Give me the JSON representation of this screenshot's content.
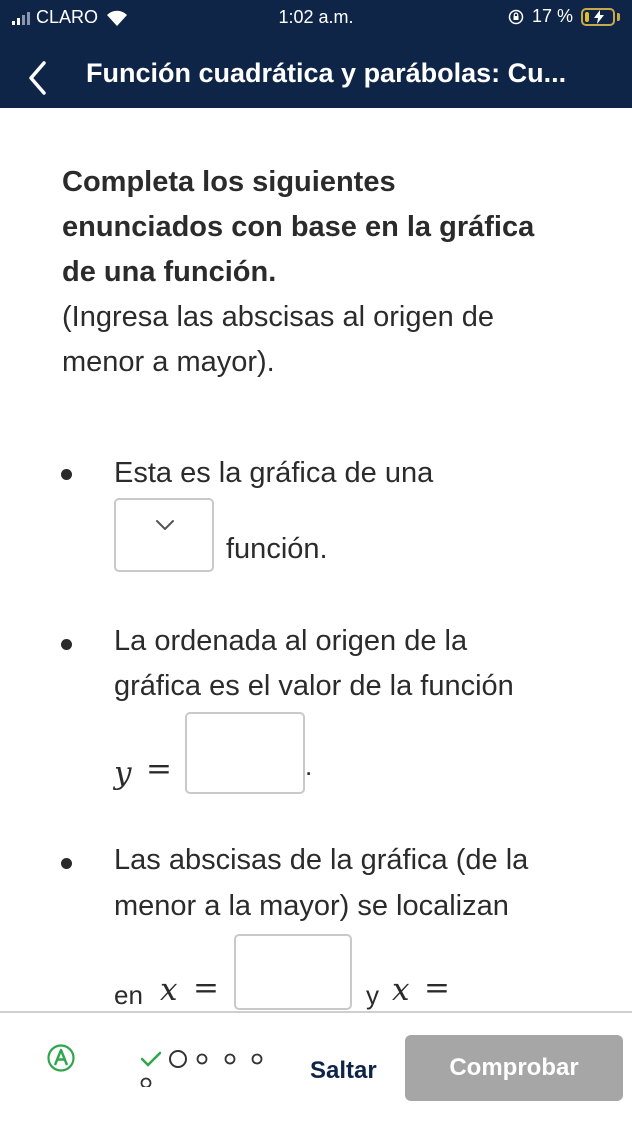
{
  "status_bar": {
    "carrier": "CLARO",
    "time": "1:02 a.m.",
    "battery": "17 %",
    "battery_level": 0.17
  },
  "header": {
    "title": "Función cuadrática y parábolas: Cu..."
  },
  "content": {
    "instruction": [
      "Completa los siguientes",
      "enunciados con base en la gráfica",
      "de una función."
    ],
    "note": [
      "(Ingresa las abscisas al origen de",
      "menor a mayor)."
    ],
    "bullet1": {
      "line1": "Esta es la gráfica de una",
      "after": "función."
    },
    "bullet2": {
      "line1": "La ordenada al origen de la",
      "line2": "gráfica es el valor de la función",
      "var": "y",
      "eq": "=",
      "period": "."
    },
    "bullet3": {
      "line1": "Las abscisas de la gráfica (de la",
      "line2": "menor a la mayor) se localizan",
      "en": "en",
      "var1": "x",
      "eq": "=",
      "y": "y",
      "var2": "x"
    }
  },
  "footer": {
    "skip_label": "Saltar",
    "check_label": "Comprobar",
    "progress_total": 5,
    "progress_done": 1
  },
  "colors": {
    "header_bg": "#0f2548",
    "check_bg": "#a6a6a6",
    "progress": "#2fa64b"
  }
}
